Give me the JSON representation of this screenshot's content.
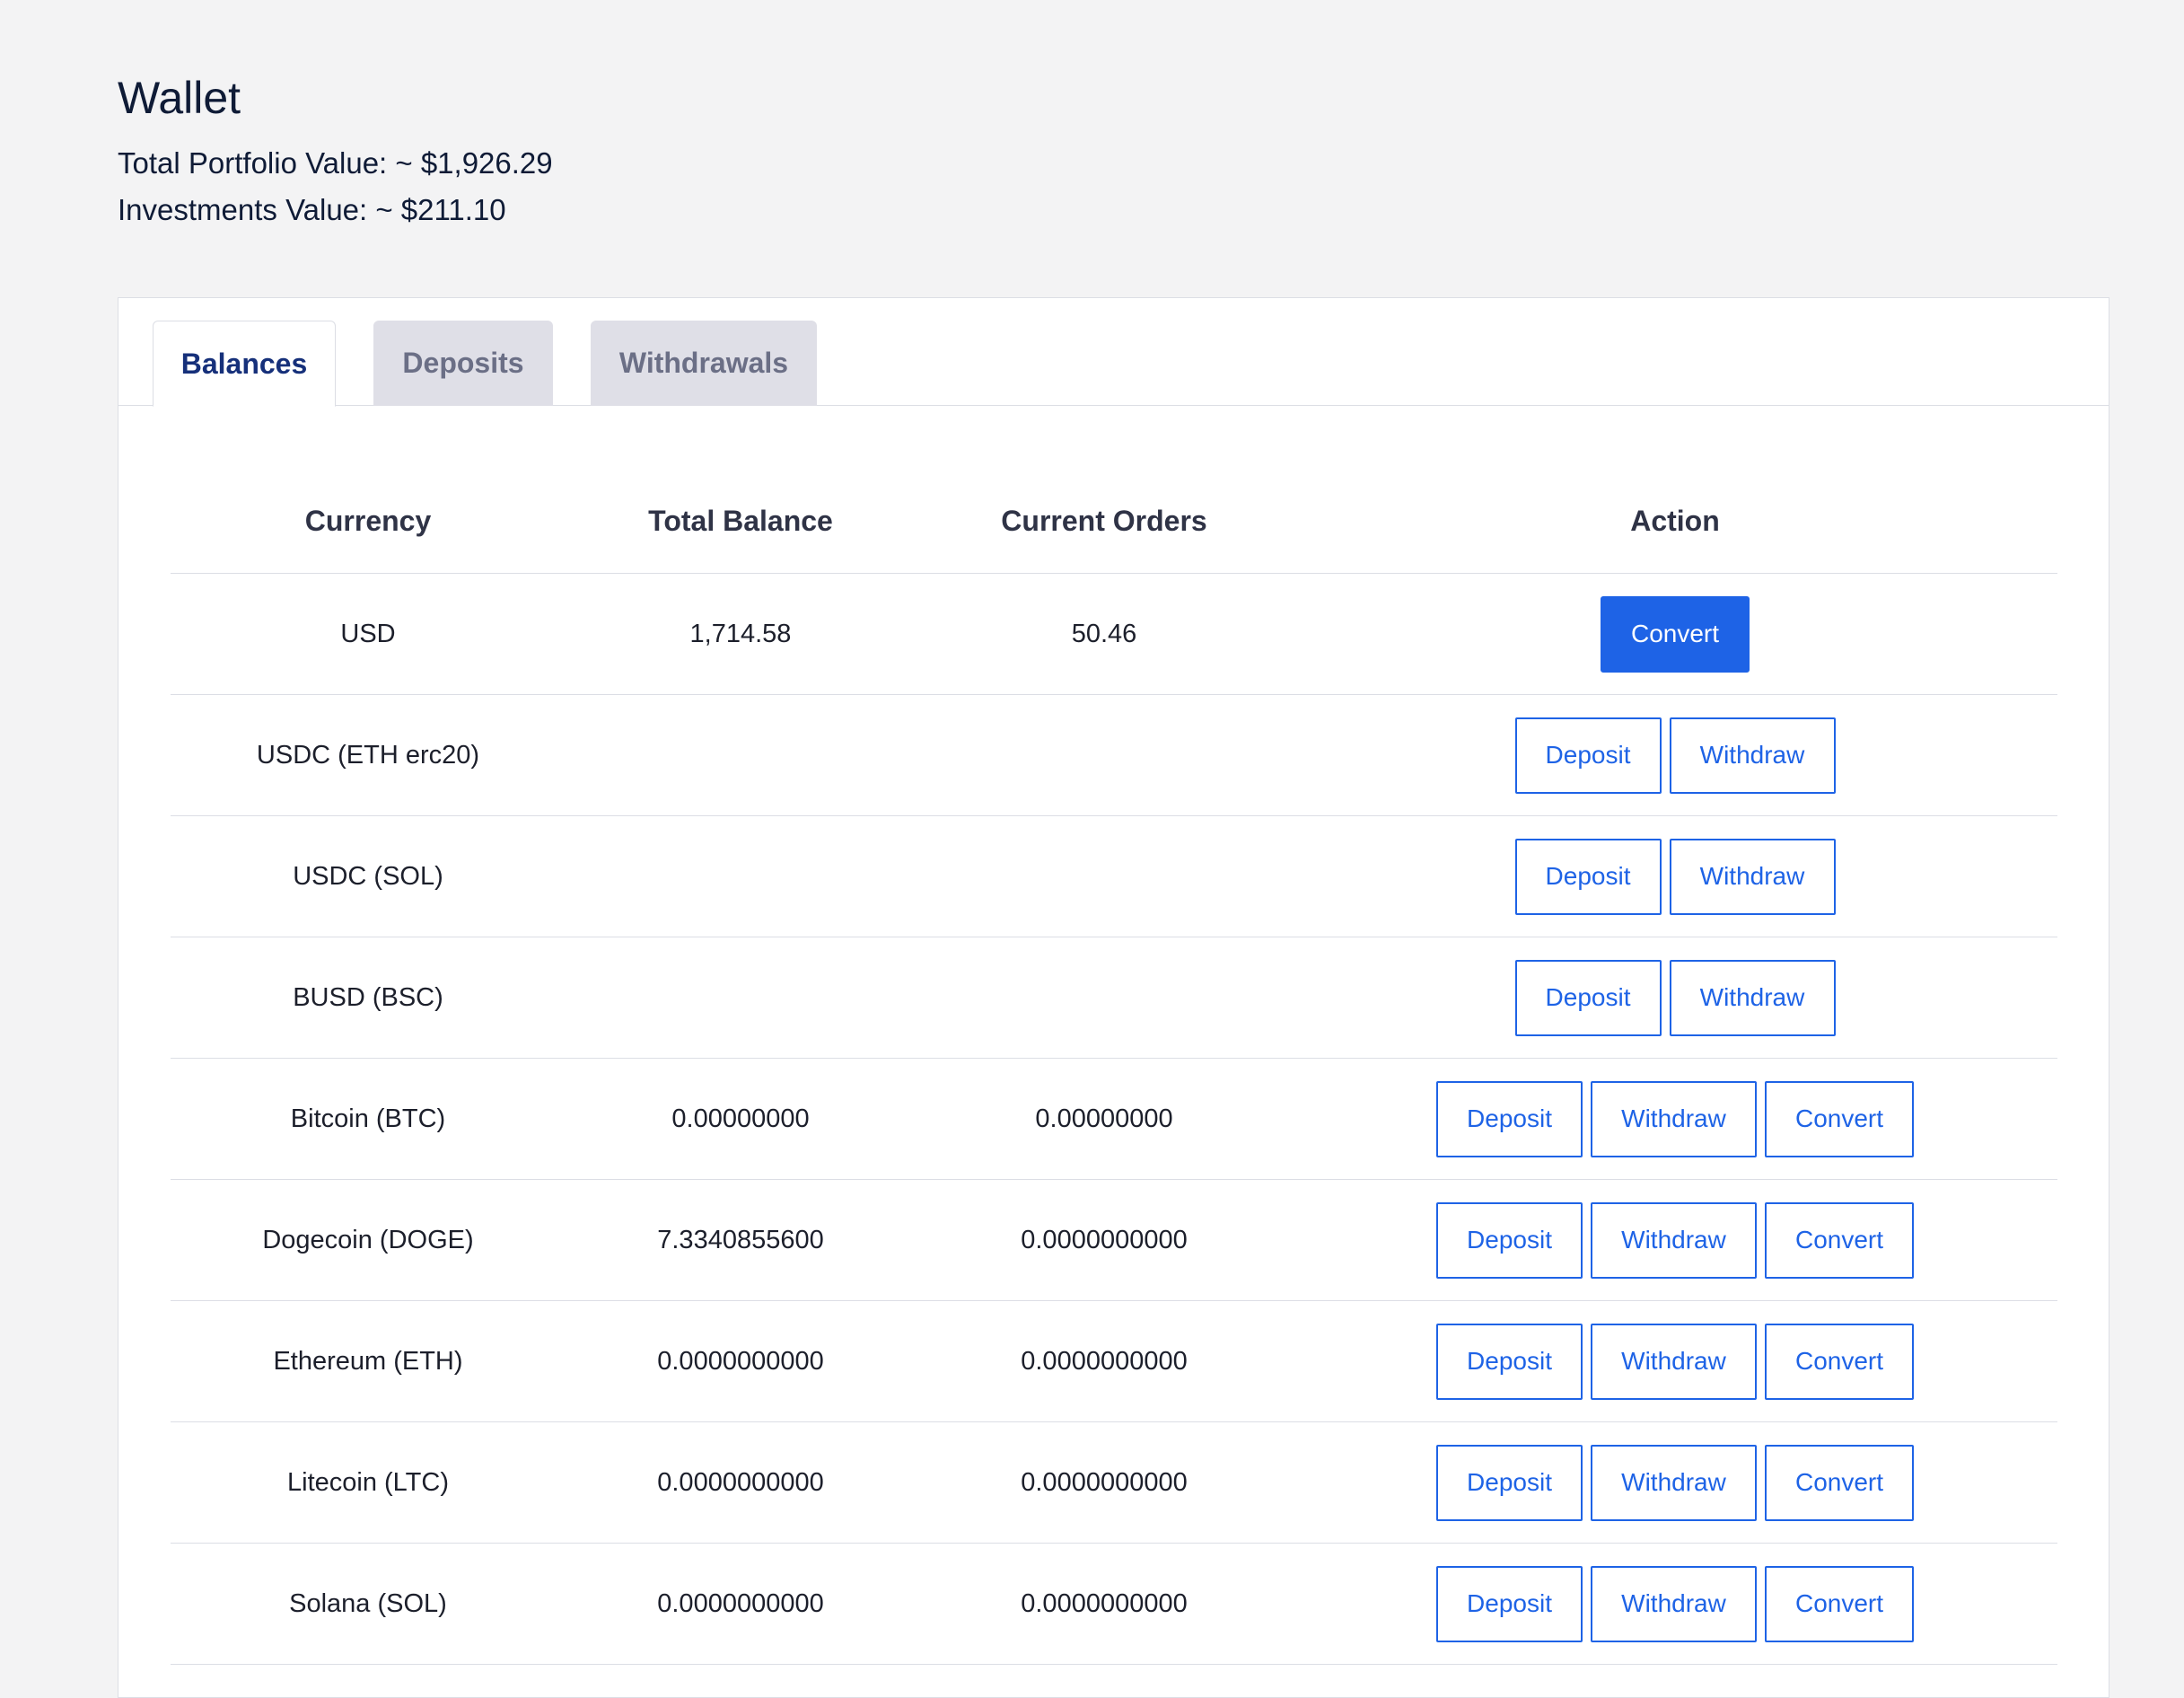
{
  "header": {
    "title": "Wallet",
    "total_portfolio": "Total Portfolio Value: ~ $1,926.29",
    "investments": "Investments Value: ~ $211.10"
  },
  "tabs": [
    {
      "label": "Balances",
      "active": true
    },
    {
      "label": "Deposits",
      "active": false
    },
    {
      "label": "Withdrawals",
      "active": false
    }
  ],
  "table": {
    "headers": [
      "Currency",
      "Total Balance",
      "Current Orders",
      "Action"
    ],
    "rows": [
      {
        "currency": "USD",
        "total_balance": "1,714.58",
        "current_orders": "50.46",
        "actions": [
          "Convert"
        ]
      },
      {
        "currency": "USDC (ETH erc20)",
        "total_balance": "",
        "current_orders": "",
        "actions": [
          "Deposit",
          "Withdraw"
        ]
      },
      {
        "currency": "USDC (SOL)",
        "total_balance": "",
        "current_orders": "",
        "actions": [
          "Deposit",
          "Withdraw"
        ]
      },
      {
        "currency": "BUSD (BSC)",
        "total_balance": "",
        "current_orders": "",
        "actions": [
          "Deposit",
          "Withdraw"
        ]
      },
      {
        "currency": "Bitcoin (BTC)",
        "total_balance": "0.00000000",
        "current_orders": "0.00000000",
        "actions": [
          "Deposit",
          "Withdraw",
          "Convert"
        ]
      },
      {
        "currency": "Dogecoin (DOGE)",
        "total_balance": "7.3340855600",
        "current_orders": "0.0000000000",
        "actions": [
          "Deposit",
          "Withdraw",
          "Convert"
        ]
      },
      {
        "currency": "Ethereum (ETH)",
        "total_balance": "0.0000000000",
        "current_orders": "0.0000000000",
        "actions": [
          "Deposit",
          "Withdraw",
          "Convert"
        ]
      },
      {
        "currency": "Litecoin (LTC)",
        "total_balance": "0.0000000000",
        "current_orders": "0.0000000000",
        "actions": [
          "Deposit",
          "Withdraw",
          "Convert"
        ]
      },
      {
        "currency": "Solana (SOL)",
        "total_balance": "0.0000000000",
        "current_orders": "0.0000000000",
        "actions": [
          "Deposit",
          "Withdraw",
          "Convert"
        ]
      }
    ]
  },
  "colors": {
    "accent": "#1e63e6",
    "active_tab_text": "#16307a",
    "inactive_tab_bg": "#dfdfe7",
    "page_bg": "#f3f3f4"
  }
}
